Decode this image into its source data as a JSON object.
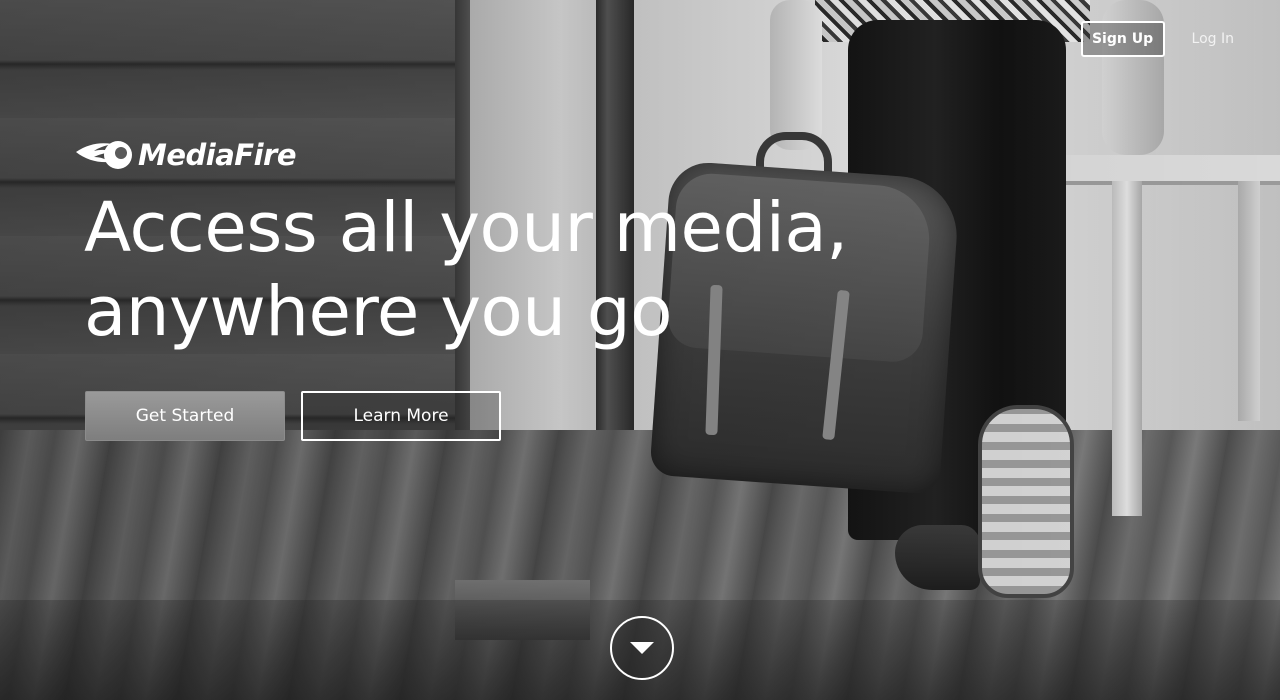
{
  "header": {
    "signup_label": "Sign Up",
    "login_label": "Log In"
  },
  "logo": {
    "brand_name": "MediaFire",
    "icon": "mediafire-flame-icon"
  },
  "hero": {
    "headline_line1": "Access all your media,",
    "headline_line2": "anywhere you go",
    "primary_cta_label": "Get Started",
    "secondary_cta_label": "Learn More",
    "scroll_icon": "chevron-down-icon"
  },
  "colors": {
    "text": "#ffffff",
    "primary_button": "#8a8a8a",
    "background_tone": "#4a4a4a"
  }
}
